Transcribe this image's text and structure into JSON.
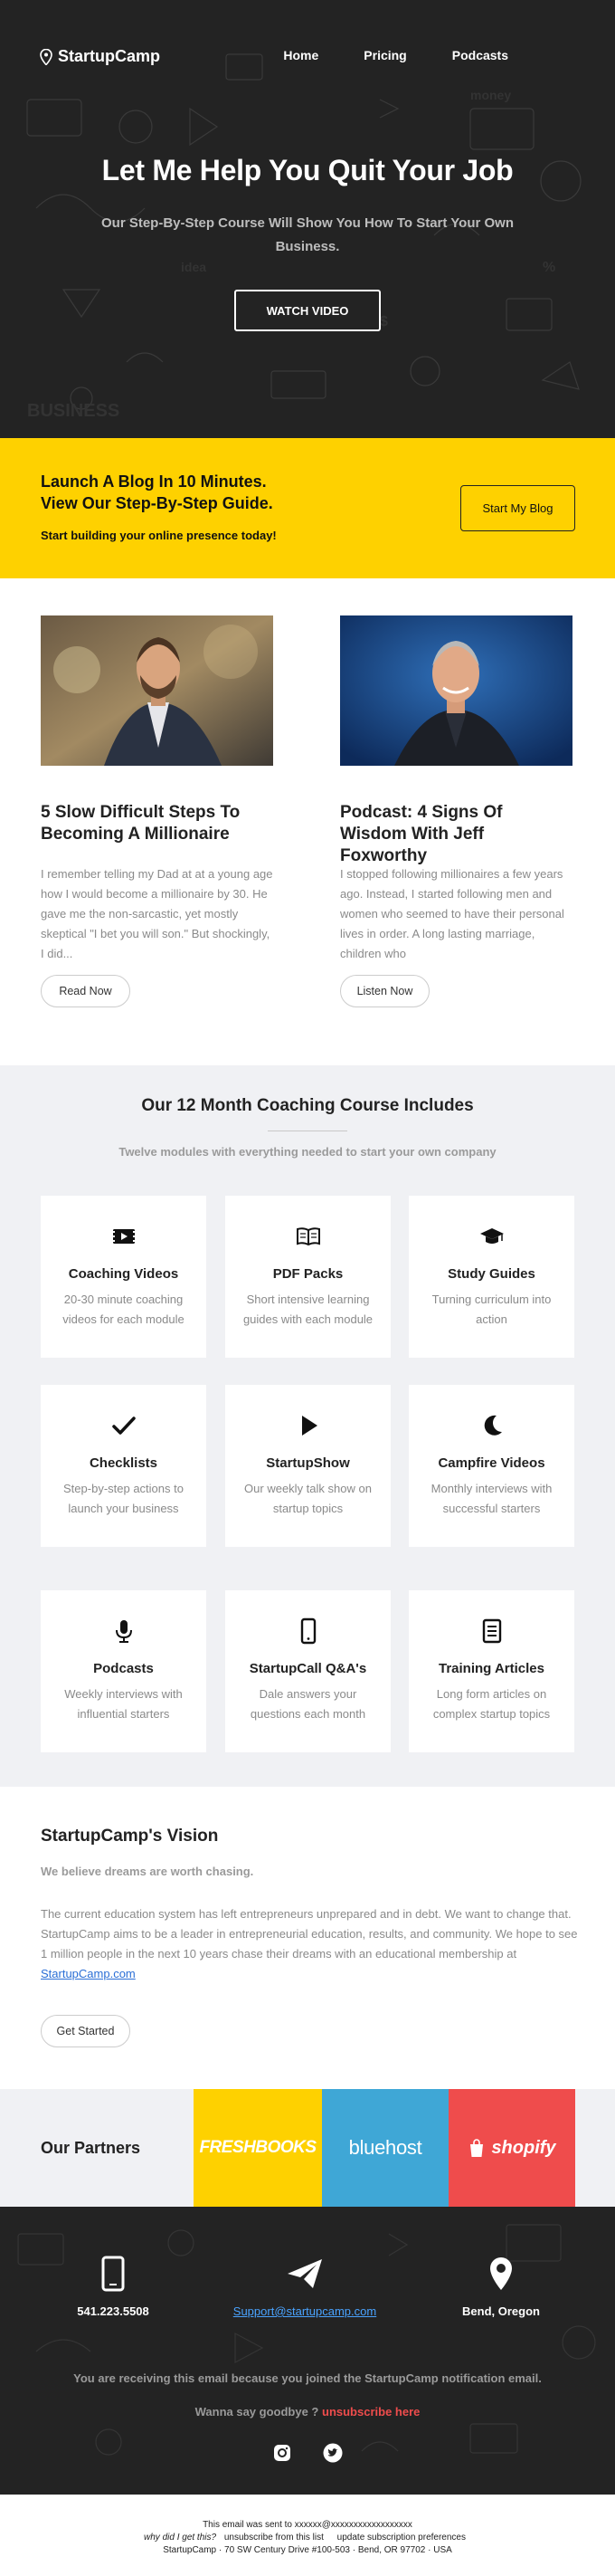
{
  "header": {
    "brand": "StartupCamp",
    "nav": [
      "Home",
      "Pricing",
      "Podcasts"
    ],
    "title": "Let Me Help You Quit Your Job",
    "subtitle": "Our Step-By-Step Course Will Show You How To Start Your Own Business.",
    "cta": "WATCH VIDEO"
  },
  "banner": {
    "title_line1": "Launch A Blog In 10 Minutes.",
    "title_line2": "View Our Step-By-Step Guide.",
    "subtitle": "Start building your online presence today!",
    "button": "Start My Blog",
    "color": "#fed100"
  },
  "articles": [
    {
      "title": "5 Slow Difficult Steps To Becoming A Millionaire",
      "excerpt": "I remember telling my Dad at at a young age how I would become a millionaire by 30. He gave me the non-sarcastic, yet mostly skeptical \"I bet you will son.\" But shockingly, I did...",
      "button": "Read Now"
    },
    {
      "title": "Podcast: 4 Signs Of Wisdom With Jeff Foxworthy",
      "excerpt": "I stopped following millionaires a few years ago. Instead, I started following men and women who seemed to have their personal lives in order. A long lasting marriage, children who",
      "button": "Listen Now"
    }
  ],
  "course": {
    "title": "Our 12 Month Coaching Course Includes",
    "subtitle": "Twelve modules with everything needed to start your own company",
    "cards": [
      {
        "icon": "video-icon",
        "title": "Coaching Videos",
        "text": "20-30 minute coaching videos for each module"
      },
      {
        "icon": "book-icon",
        "title": "PDF Packs",
        "text": "Short intensive learning guides with each module"
      },
      {
        "icon": "graduation-cap-icon",
        "title": "Study Guides",
        "text": "Turning curriculum into action"
      },
      {
        "icon": "checkmark-icon",
        "title": "Checklists",
        "text": "Step-by-step actions to launch your business"
      },
      {
        "icon": "play-icon",
        "title": "StartupShow",
        "text": "Our weekly talk show on startup topics"
      },
      {
        "icon": "moon-icon",
        "title": "Campfire Videos",
        "text": "Monthly interviews with successful starters"
      },
      {
        "icon": "microphone-icon",
        "title": "Podcasts",
        "text": "Weekly interviews with influential starters"
      },
      {
        "icon": "phone-icon",
        "title": "StartupCall Q&A's",
        "text": "Dale answers your questions each month"
      },
      {
        "icon": "article-icon",
        "title": "Training Articles",
        "text": "Long form articles on complex startup topics"
      }
    ]
  },
  "vision": {
    "title": "StartupCamp's Vision",
    "tagline": "We believe dreams are worth chasing.",
    "text": "The current education system has left entrepreneurs unprepared and in debt. We want to change that. StartupCamp aims to be a leader in entrepreneurial education, results, and community. We hope to see 1 million people in the next 10 years chase their dreams with an educational membership at ",
    "link": "StartupCamp.com",
    "button": "Get Started"
  },
  "partners": {
    "label": "Our Partners",
    "names": [
      "FRESHBOOKS",
      "bluehost",
      "shopify"
    ],
    "colors": [
      "#fed100",
      "#3fa7d6",
      "#ef4c4c"
    ]
  },
  "footer": {
    "phone": "541.223.5508",
    "email": "Support@startupcamp.com",
    "location": "Bend, Oregon",
    "notice": "You are receiving this email because you joined the StartupCamp notification email.",
    "bye_text": "Wanna say goodbye ?",
    "unsubscribe": "unsubscribe here"
  },
  "bottom": {
    "sent_to": "This email was sent to xxxxxx@xxxxxxxxxxxxxxxxxx",
    "why": "why did I get this?",
    "unsubscribe_list": "unsubscribe from this list",
    "update_prefs": "update subscription preferences",
    "address": "StartupCamp · 70 SW Century Drive #100-503 · Bend, OR 97702 · USA"
  }
}
